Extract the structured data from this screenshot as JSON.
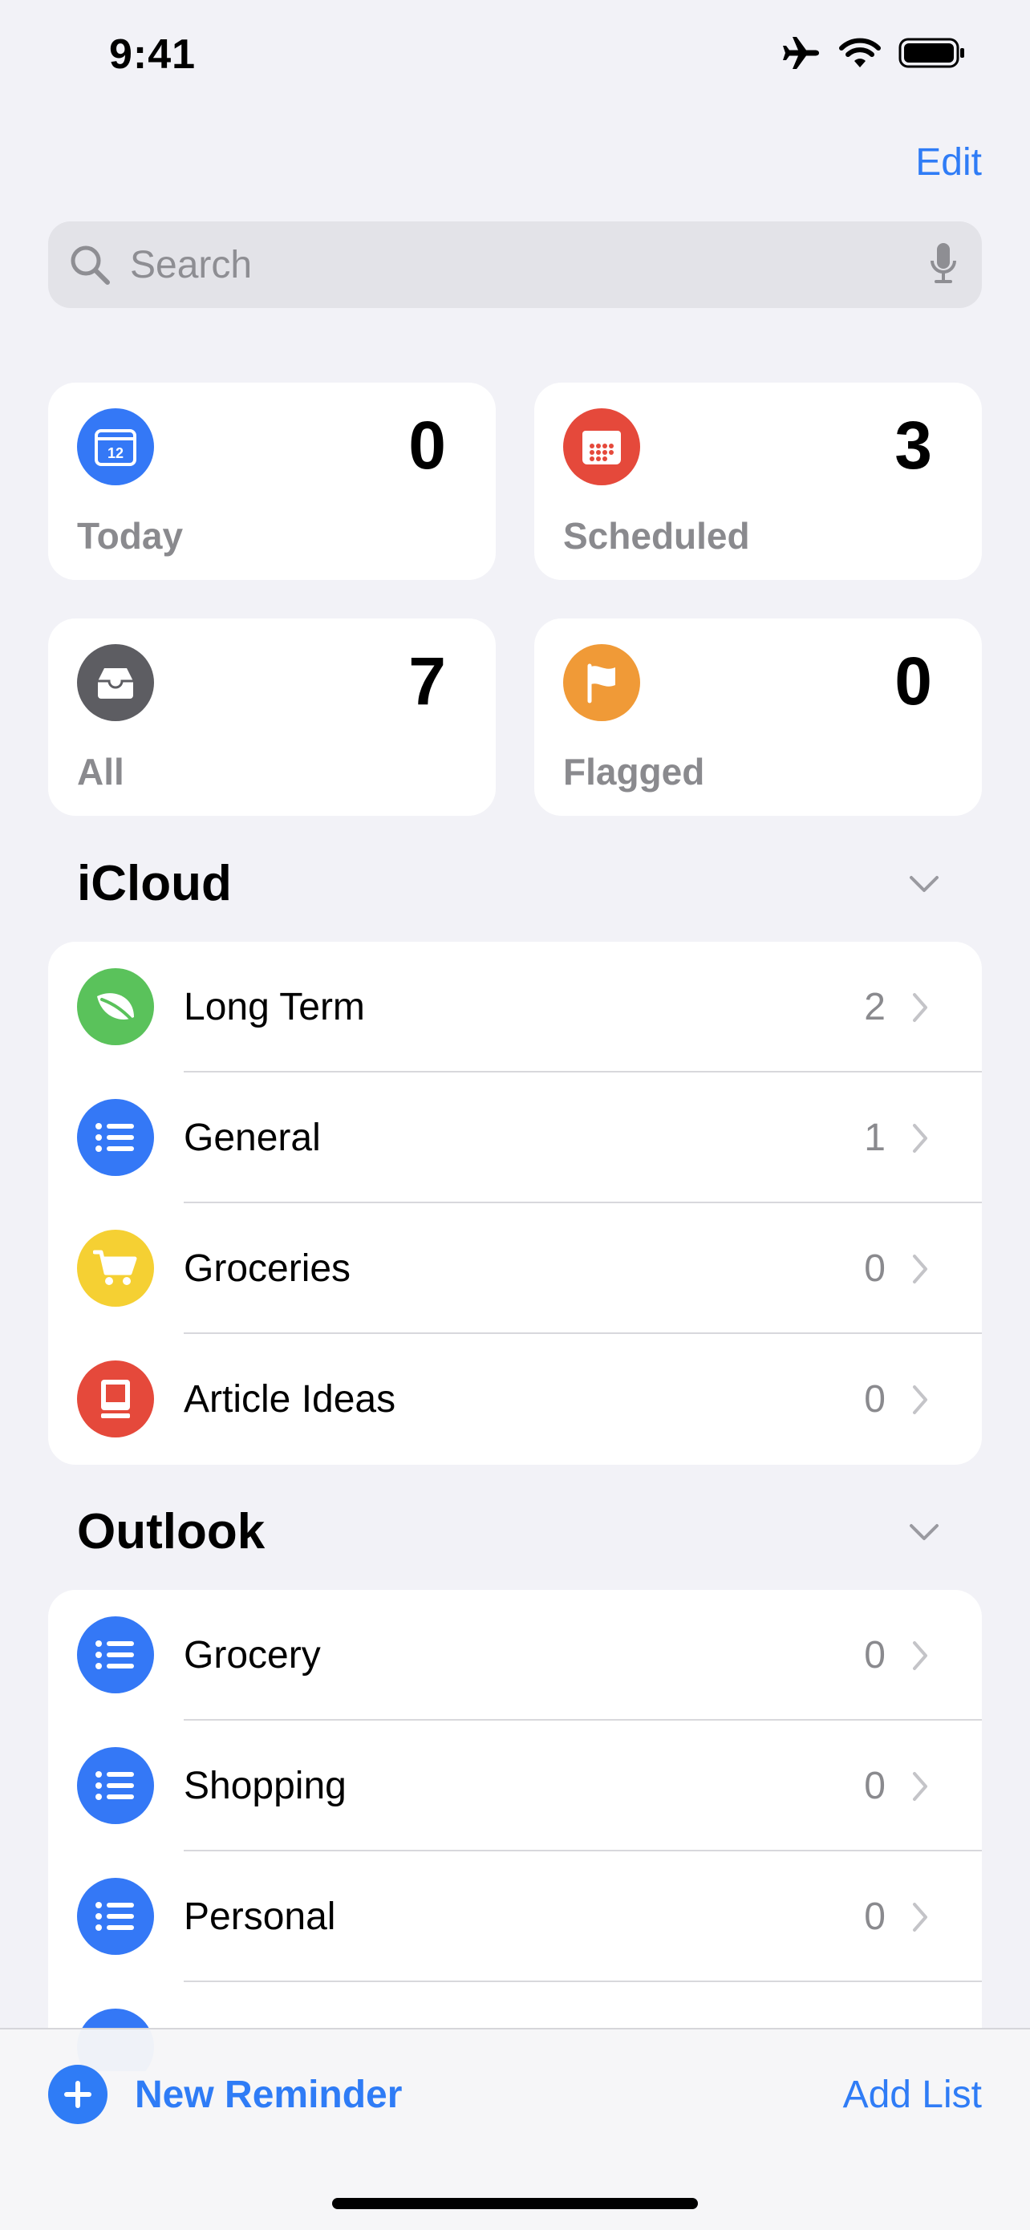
{
  "status_bar": {
    "time": "9:41",
    "icons": [
      "airplane-icon",
      "wifi-icon",
      "battery-icon"
    ]
  },
  "header": {
    "edit_label": "Edit"
  },
  "search": {
    "placeholder": "Search",
    "icons": [
      "search-icon",
      "microphone-icon"
    ]
  },
  "smart_lists": [
    {
      "label": "Today",
      "count": "0",
      "icon": "calendar-today-icon",
      "color": "#3478F6"
    },
    {
      "label": "Scheduled",
      "count": "3",
      "icon": "calendar-grid-icon",
      "color": "#E5493B"
    },
    {
      "label": "All",
      "count": "7",
      "icon": "tray-icon",
      "color": "#5D5D62"
    },
    {
      "label": "Flagged",
      "count": "0",
      "icon": "flag-icon",
      "color": "#F09A37"
    }
  ],
  "sections": [
    {
      "title": "iCloud",
      "lists": [
        {
          "label": "Long Term",
          "count": "2",
          "icon": "leaf-icon",
          "color": "#5AC25B"
        },
        {
          "label": "General",
          "count": "1",
          "icon": "list-bullet-icon",
          "color": "#3478F6"
        },
        {
          "label": "Groceries",
          "count": "0",
          "icon": "cart-icon",
          "color": "#F5D033"
        },
        {
          "label": "Article Ideas",
          "count": "0",
          "icon": "desktop-icon",
          "color": "#E5493B"
        }
      ]
    },
    {
      "title": "Outlook",
      "lists": [
        {
          "label": "Grocery",
          "count": "0",
          "icon": "list-bullet-icon",
          "color": "#3478F6"
        },
        {
          "label": "Shopping",
          "count": "0",
          "icon": "list-bullet-icon",
          "color": "#3478F6"
        },
        {
          "label": "Personal",
          "count": "0",
          "icon": "list-bullet-icon",
          "color": "#3478F6"
        }
      ]
    }
  ],
  "toolbar": {
    "new_reminder_label": "New Reminder",
    "add_list_label": "Add List"
  },
  "colors": {
    "accent": "#2F7CF6",
    "background": "#F2F2F7"
  }
}
